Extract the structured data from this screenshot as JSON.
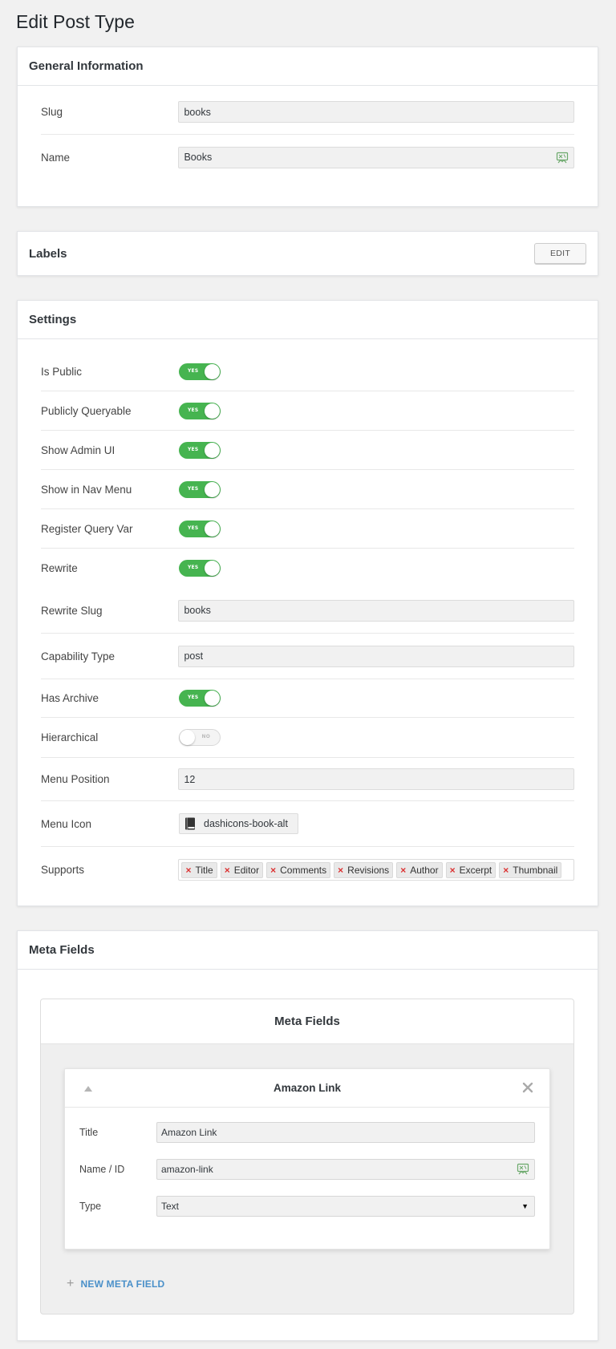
{
  "page": {
    "title": "Edit Post Type"
  },
  "general": {
    "title": "General Information",
    "slug_label": "Slug",
    "slug_value": "books",
    "name_label": "Name",
    "name_value": "Books",
    "name_icon": "translate-icon"
  },
  "labels": {
    "title": "Labels",
    "edit_label": "EDIT"
  },
  "settings": {
    "title": "Settings",
    "toggle_rows": [
      {
        "label": "Is Public",
        "on": true,
        "text": "YES"
      },
      {
        "label": "Publicly Queryable",
        "on": true,
        "text": "YES"
      },
      {
        "label": "Show Admin UI",
        "on": true,
        "text": "YES"
      },
      {
        "label": "Show in Nav Menu",
        "on": true,
        "text": "YES"
      },
      {
        "label": "Register Query Var",
        "on": true,
        "text": "YES"
      },
      {
        "label": "Rewrite",
        "on": true,
        "text": "YES"
      }
    ],
    "rewrite_slug_label": "Rewrite Slug",
    "rewrite_slug_value": "books",
    "capability_type_label": "Capability Type",
    "capability_type_value": "post",
    "has_archive_label": "Has Archive",
    "has_archive_text": "YES",
    "hierarchical_label": "Hierarchical",
    "hierarchical_text": "NO",
    "menu_position_label": "Menu Position",
    "menu_position_value": "12",
    "menu_icon_label": "Menu Icon",
    "menu_icon_value": "dashicons-book-alt",
    "supports_label": "Supports",
    "supports": [
      "Title",
      "Editor",
      "Comments",
      "Revisions",
      "Author",
      "Excerpt",
      "Thumbnail"
    ]
  },
  "meta": {
    "panel_title": "Meta Fields",
    "inner_title": "Meta Fields",
    "field": {
      "header": "Amazon Link",
      "title_label": "Title",
      "title_value": "Amazon Link",
      "name_label": "Name / ID",
      "name_value": "amazon-link",
      "type_label": "Type",
      "type_value": "Text"
    },
    "new_field_label": "NEW META FIELD"
  },
  "colors": {
    "toggle_on": "#46b450",
    "link": "#4a90c9",
    "remove": "#dc3232"
  }
}
